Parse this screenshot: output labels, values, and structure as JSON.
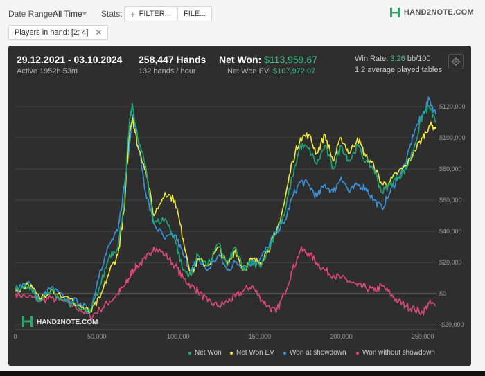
{
  "toolbar": {
    "date_range_label": "Date Range:",
    "date_range_value": "All Time",
    "stats_label": "Stats:",
    "filter_button": "FILTER...",
    "file_button": "FILE...",
    "chip_label": "Players in hand: [2; 4]",
    "brand": "HAND2NOTE.COM"
  },
  "summary": {
    "date_span": "29.12.2021 - 03.10.2024",
    "active": "Active 1952h 53m",
    "hands": "258,447 Hands",
    "hands_rate": "132 hands / hour",
    "net_won_label": "Net Won:",
    "net_won_value": "$113,959.67",
    "net_won_ev_label": "Net Won  EV:",
    "net_won_ev_value": "$107,972.07",
    "win_rate_label": "Win Rate:",
    "win_rate_value": "3.26",
    "win_rate_unit": "bb/100",
    "avg_tables": "1.2 average played tables"
  },
  "watermark": "HAND2NOTE.COM",
  "colors": {
    "net_won": "#1aa877",
    "net_won_ev": "#f2ea3a",
    "won_showdown": "#3a95e0",
    "won_without_showdown": "#e0487a"
  },
  "chart_data": {
    "type": "line",
    "xlim": [
      0,
      258447
    ],
    "ylim": [
      -23000,
      128000
    ],
    "x_ticks": [
      0,
      50000,
      100000,
      150000,
      200000,
      250000
    ],
    "x_tick_labels": [
      "0",
      "50,000",
      "100,000",
      "150,000",
      "200,000",
      "250,000"
    ],
    "y_ticks": [
      -20000,
      0,
      20000,
      40000,
      60000,
      80000,
      100000,
      120000
    ],
    "y_tick_labels": [
      "-$20,000",
      "$0",
      "$20,000",
      "$40,000",
      "$60,000",
      "$80,000",
      "$100,000",
      "$120,000"
    ],
    "grid": true,
    "legend_position": "bottom",
    "series": [
      {
        "name": "Net Won",
        "color": "#1aa877",
        "x": [
          0,
          8000,
          15000,
          22000,
          30000,
          40000,
          46000,
          52000,
          58000,
          63000,
          67000,
          70000,
          72000,
          75000,
          80000,
          85000,
          92000,
          98000,
          103000,
          108000,
          112000,
          118000,
          125000,
          130000,
          135000,
          140000,
          145000,
          150000,
          155000,
          160000,
          165000,
          170000,
          175000,
          180000,
          185000,
          190000,
          195000,
          200000,
          205000,
          210000,
          215000,
          220000,
          225000,
          230000,
          235000,
          240000,
          245000,
          250000,
          254000,
          258000
        ],
        "y": [
          3000,
          5000,
          -5000,
          2000,
          -4000,
          -10000,
          -12000,
          5000,
          25000,
          30000,
          60000,
          110000,
          121000,
          100000,
          82000,
          45000,
          48000,
          35000,
          15000,
          12000,
          25000,
          18000,
          32000,
          18000,
          30000,
          15000,
          20000,
          18000,
          28000,
          40000,
          50000,
          75000,
          95000,
          93000,
          83000,
          95000,
          80000,
          95000,
          85000,
          95000,
          85000,
          80000,
          65000,
          70000,
          75000,
          80000,
          95000,
          115000,
          120000,
          110000
        ]
      },
      {
        "name": "Net Won  EV",
        "color": "#f2ea3a",
        "x": [
          0,
          8000,
          15000,
          22000,
          30000,
          40000,
          46000,
          52000,
          58000,
          63000,
          67000,
          70000,
          72000,
          75000,
          80000,
          85000,
          92000,
          98000,
          103000,
          108000,
          112000,
          118000,
          125000,
          130000,
          135000,
          140000,
          145000,
          150000,
          155000,
          160000,
          165000,
          170000,
          175000,
          180000,
          185000,
          190000,
          195000,
          200000,
          205000,
          210000,
          215000,
          220000,
          225000,
          230000,
          235000,
          240000,
          245000,
          250000,
          254000,
          258000
        ],
        "y": [
          2000,
          6000,
          -3000,
          3000,
          -2000,
          -8000,
          -12000,
          -3000,
          15000,
          25000,
          55000,
          105000,
          113000,
          95000,
          80000,
          50000,
          65000,
          60000,
          35000,
          12000,
          22000,
          18000,
          30000,
          18000,
          28000,
          15000,
          22000,
          20000,
          28000,
          38000,
          58000,
          85000,
          100000,
          102000,
          90000,
          102000,
          85000,
          100000,
          90000,
          100000,
          88000,
          82000,
          70000,
          72000,
          78000,
          82000,
          92000,
          100000,
          108000,
          107000
        ]
      },
      {
        "name": "Won at showdown",
        "color": "#3a95e0",
        "x": [
          0,
          8000,
          15000,
          22000,
          30000,
          40000,
          46000,
          52000,
          58000,
          63000,
          67000,
          70000,
          72000,
          75000,
          80000,
          85000,
          92000,
          98000,
          103000,
          108000,
          112000,
          118000,
          125000,
          130000,
          135000,
          140000,
          145000,
          150000,
          155000,
          160000,
          165000,
          170000,
          175000,
          180000,
          185000,
          190000,
          195000,
          200000,
          205000,
          210000,
          215000,
          220000,
          225000,
          230000,
          235000,
          240000,
          245000,
          250000,
          254000,
          258000
        ],
        "y": [
          4000,
          8000,
          -4000,
          4000,
          -3000,
          -6000,
          -12000,
          15000,
          32000,
          40000,
          70000,
          95000,
          115000,
          100000,
          65000,
          45000,
          35000,
          38000,
          25000,
          15000,
          22000,
          15000,
          25000,
          15000,
          20000,
          18000,
          20000,
          22000,
          30000,
          40000,
          45000,
          62000,
          72000,
          70000,
          62000,
          70000,
          65000,
          75000,
          65000,
          70000,
          68000,
          60000,
          55000,
          65000,
          75000,
          85000,
          105000,
          115000,
          125000,
          115000
        ]
      },
      {
        "name": "Won without showdown",
        "color": "#e0487a",
        "x": [
          0,
          8000,
          15000,
          22000,
          30000,
          40000,
          46000,
          52000,
          58000,
          63000,
          67000,
          70000,
          72000,
          75000,
          80000,
          85000,
          92000,
          98000,
          103000,
          108000,
          112000,
          118000,
          125000,
          130000,
          135000,
          140000,
          145000,
          150000,
          155000,
          160000,
          165000,
          170000,
          175000,
          180000,
          185000,
          190000,
          195000,
          200000,
          205000,
          210000,
          215000,
          220000,
          225000,
          230000,
          235000,
          240000,
          245000,
          250000,
          254000,
          258000
        ],
        "y": [
          0,
          -2000,
          -4000,
          -3000,
          -5000,
          -10000,
          -15000,
          -10000,
          -5000,
          0,
          5000,
          10000,
          15000,
          18000,
          22000,
          30000,
          25000,
          18000,
          10000,
          5000,
          2000,
          -5000,
          -8000,
          -5000,
          -2000,
          2000,
          5000,
          -2000,
          -8000,
          -12000,
          0,
          15000,
          28000,
          26000,
          20000,
          15000,
          12000,
          10000,
          8000,
          5000,
          4000,
          2000,
          5000,
          0,
          -5000,
          -8000,
          -10000,
          -12000,
          -6000,
          -8000
        ]
      }
    ]
  }
}
